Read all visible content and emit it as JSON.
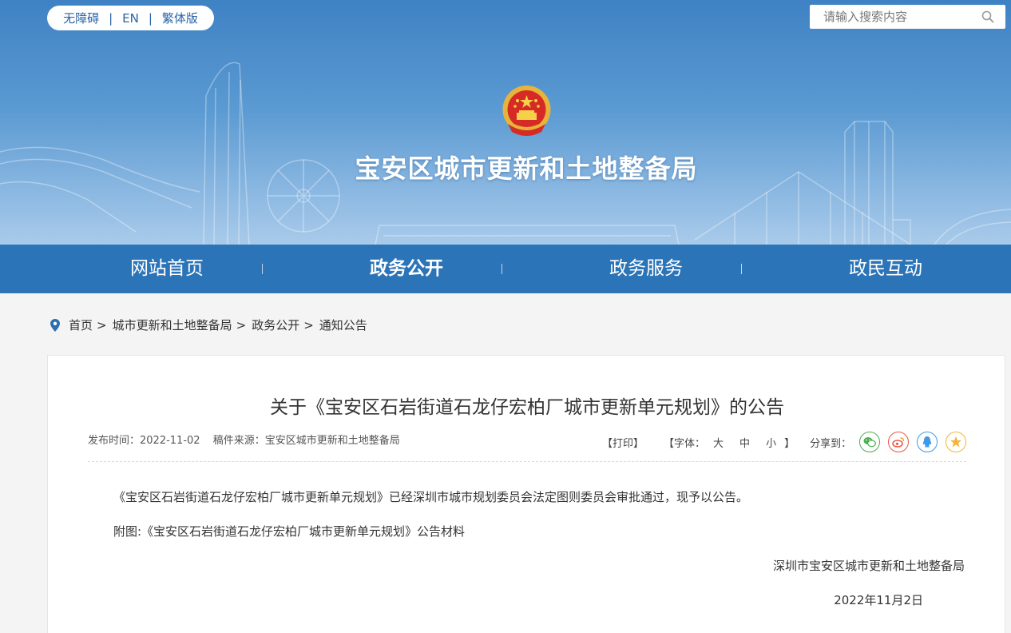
{
  "topbar": {
    "links": [
      "无障碍",
      "EN",
      "繁体版"
    ],
    "separator": "|",
    "search_placeholder": "请输入搜索内容"
  },
  "header": {
    "site_title": "宝安区城市更新和土地整备局"
  },
  "nav": {
    "items": [
      "网站首页",
      "政务公开",
      "政务服务",
      "政民互动"
    ],
    "active": "政务公开"
  },
  "breadcrumb": {
    "items": [
      "首页",
      "城市更新和土地整备局",
      "政务公开",
      "通知公告"
    ],
    "separator": ">"
  },
  "article": {
    "title": "关于《宝安区石岩街道石龙仔宏柏厂城市更新单元规划》的公告",
    "publish_label": "发布时间：",
    "publish_date": "2022-11-02",
    "source_label": "稿件来源：",
    "source": "宝安区城市更新和土地整备局",
    "print": "【打印】",
    "font_label": "【字体：",
    "font_sizes": [
      "大",
      "中",
      "小"
    ],
    "font_close": "】",
    "share_label": "分享到：",
    "share_icons": [
      "wechat-icon",
      "weibo-icon",
      "qq-icon",
      "favorite-icon"
    ],
    "share_colors": [
      "#4caf50",
      "#e8574a",
      "#3d9ae8",
      "#f4b53a"
    ],
    "paragraphs": [
      "《宝安区石岩街道石龙仔宏柏厂城市更新单元规划》已经深圳市城市规划委员会法定图则委员会审批通过，现予以公告。",
      "附图:《宝安区石岩街道石龙仔宏柏厂城市更新单元规划》公告材料"
    ],
    "signature": "深圳市宝安区城市更新和土地整备局",
    "date": "2022年11月2日"
  }
}
